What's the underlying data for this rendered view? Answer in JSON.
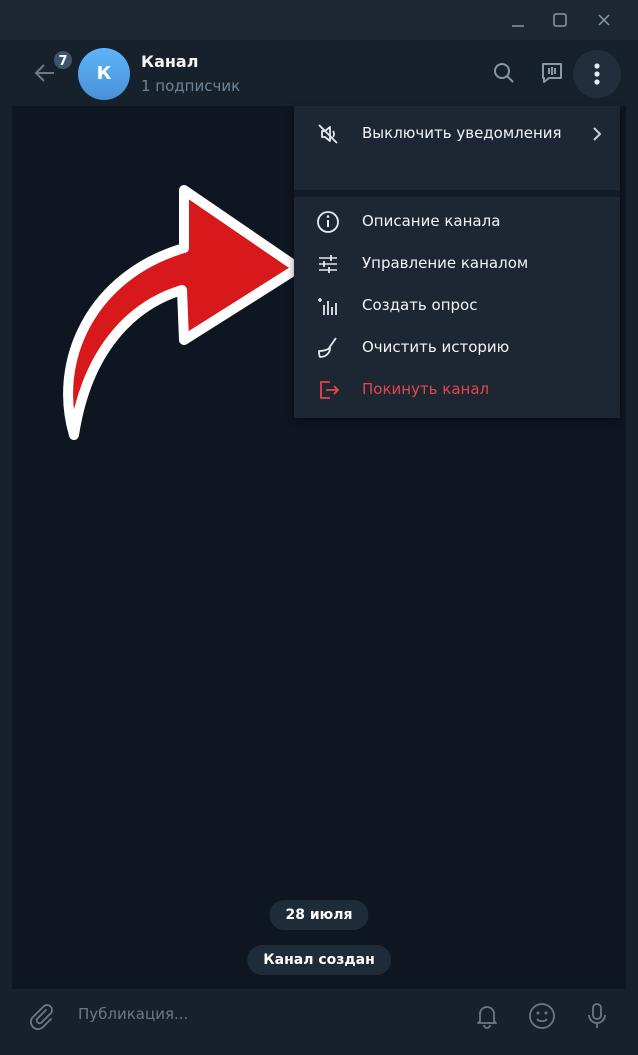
{
  "window_controls": [
    {
      "name": "minimize-icon"
    },
    {
      "name": "maximize-icon"
    },
    {
      "name": "close-icon"
    }
  ],
  "header": {
    "back_icon": "arrow-left-icon",
    "unread_badge": "7",
    "avatar_letter": "К",
    "title": "Канал",
    "subtitle": "1 подписчик",
    "icons": [
      "search-icon",
      "live-stream-icon",
      "more-vertical-icon"
    ]
  },
  "menu": {
    "items": [
      {
        "label": "Выключить уведомления",
        "icon": "mute-icon",
        "has_submenu": true
      },
      {
        "label": "Описание канала",
        "icon": "info-icon"
      },
      {
        "label": "Управление каналом",
        "icon": "sliders-icon"
      },
      {
        "label": "Создать опрос",
        "icon": "poll-icon"
      },
      {
        "label": "Очистить историю",
        "icon": "broom-icon"
      },
      {
        "label": "Покинуть канал",
        "icon": "leave-icon",
        "danger": true
      }
    ]
  },
  "messages": {
    "date": "28 июля",
    "service": "Канал создан"
  },
  "composer": {
    "placeholder": "Публикация...",
    "icons": [
      "attach-icon",
      "bell-icon",
      "emoji-icon",
      "microphone-icon"
    ]
  },
  "colors": {
    "accent": "#5eb5f7",
    "danger": "#e5454b",
    "background": "#0e1621",
    "panel": "#17212b",
    "annotation_arrow": "#d7191c"
  }
}
